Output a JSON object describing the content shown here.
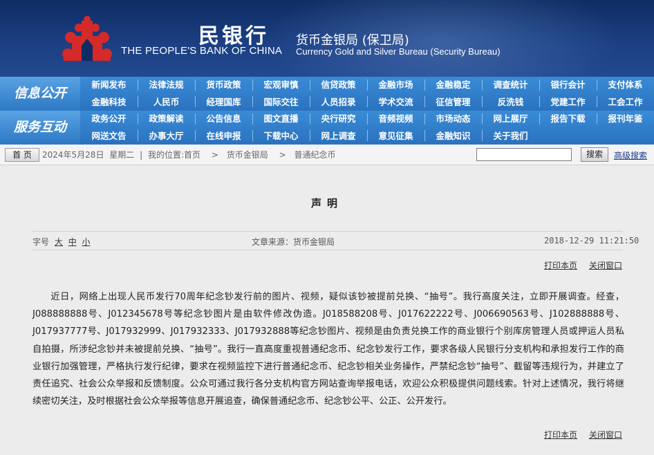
{
  "header": {
    "title_cn": "民银行",
    "title_en": "THE PEOPLE'S BANK OF CHINA",
    "bureau_cn": "货币金银局 (保卫局)",
    "bureau_en": "Currency  Gold and Silver Bureau (Security Bureau)",
    "colors": {
      "banner": "#1b3f82",
      "logo": "#d42a2a",
      "nav": "#2e7cc8"
    }
  },
  "nav": {
    "section1_label": "信息公开",
    "section2_label": "服务互动",
    "row1": [
      "新闻发布",
      "法律法规",
      "货币政策",
      "宏观审慎",
      "信贷政策",
      "金融市场",
      "金融稳定",
      "调查统计",
      "银行会计",
      "支付体系"
    ],
    "row2": [
      "金融科技",
      "人民币",
      "经理国库",
      "国际交往",
      "人员招录",
      "学术交流",
      "征信管理",
      "反洗钱",
      "党建工作",
      "工会工作"
    ],
    "row3": [
      "政务公开",
      "政策解读",
      "公告信息",
      "图文直播",
      "央行研究",
      "音频视频",
      "市场动态",
      "网上展厅",
      "报告下载",
      "报刊年鉴"
    ],
    "row4": [
      "网送文告",
      "办事大厅",
      "在线申报",
      "下载中心",
      "网上调查",
      "意见征集",
      "金融知识",
      "关于我们"
    ]
  },
  "breadcrumb": {
    "home": "首 页",
    "date": "2024年5月28日",
    "weekday": "星期二",
    "location_label": "我的位置:首页",
    "level1": "货币金银局",
    "level2": "普通纪念币",
    "sep": ">",
    "divider": "|",
    "search_button": "搜索",
    "advanced_search": "高级搜索"
  },
  "article": {
    "title": "声明",
    "font_label": "字号",
    "font_large": "大",
    "font_medium": "中",
    "font_small": "小",
    "source": "文章来源：货币金银局",
    "date": "2018-12-29 11:21:50",
    "print": "打印本页",
    "close": "关闭窗口",
    "body": "近日，网络上出现人民币发行70周年纪念钞发行前的图片、视频，疑似该钞被提前兑换、“抽号”。我行高度关注，立即开展调查。经查，J088888888号、J012345678号等纪念钞图片是由软件修改伪造。J018588208号、J017622222号、J006690563号、J102888888号、J017937777号、J017932999、J017932333、J017932888等纪念钞图片、视频是由负责兑换工作的商业银行个别库房管理人员或押运人员私自拍摄，所涉纪念钞并未被提前兑换、“抽号”。我行一直高度重视普通纪念币、纪念钞发行工作，要求各级人民银行分支机构和承担发行工作的商业银行加强管理，严格执行发行纪律，要求在视频监控下进行普通纪念币、纪念钞相关业务操作，严禁纪念钞“抽号”、截留等违规行为，并建立了责任追究、社会公众举报和反馈制度。公众可通过我行各分支机构官方网站查询举报电话，欢迎公众积极提供问题线索。针对上述情况，我行将继续密切关注，及时根据社会公众举报等信息开展追查，确保普通纪念币、纪念钞公平、公正、公开发行。"
  }
}
